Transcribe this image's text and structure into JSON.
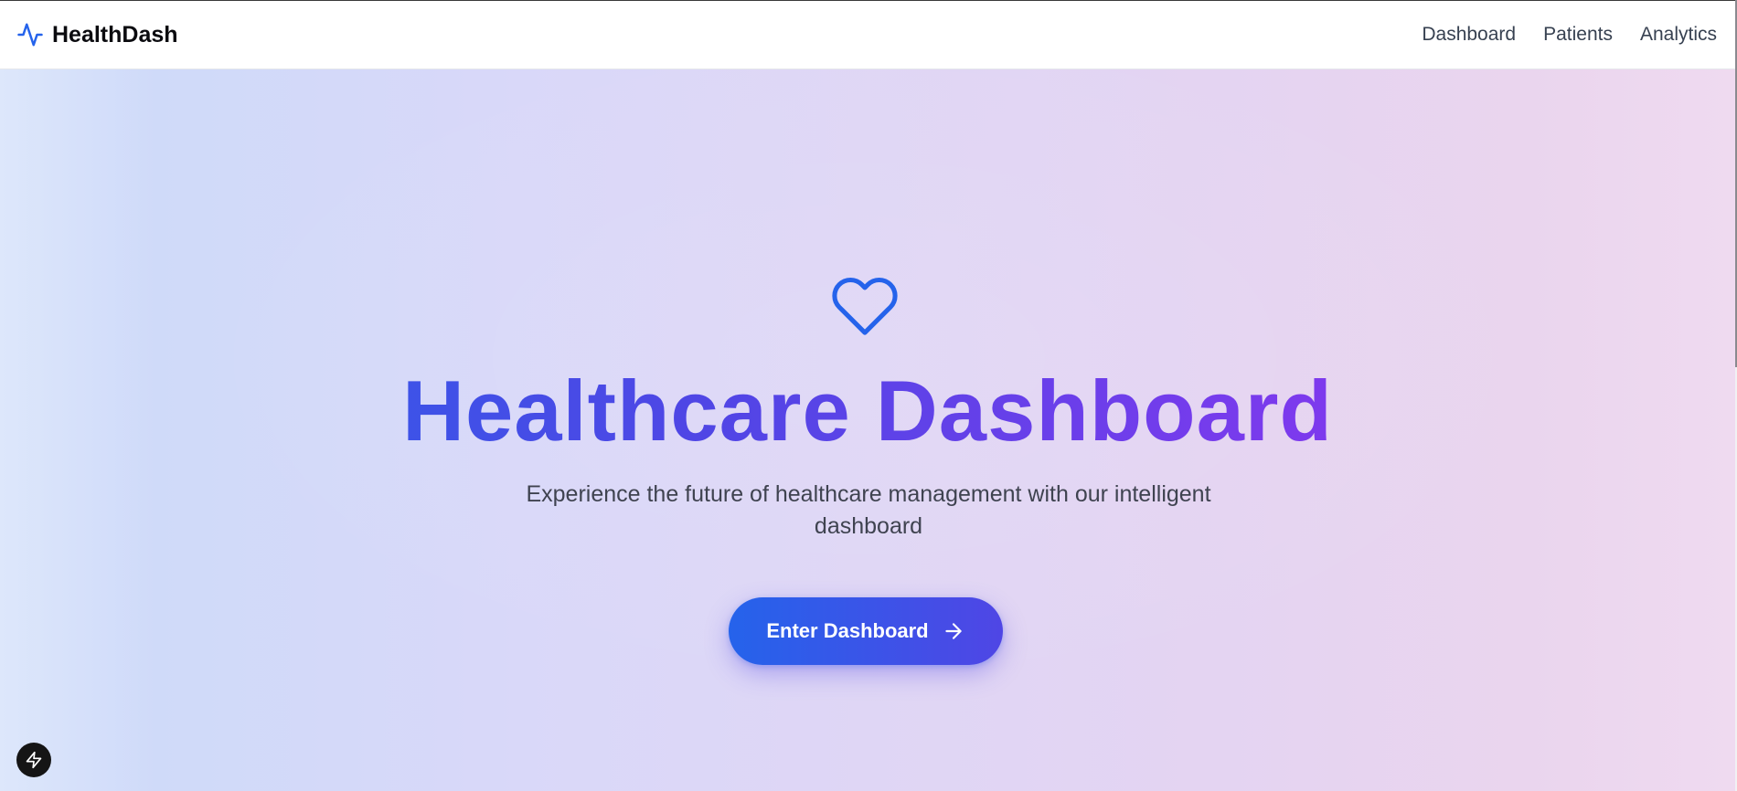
{
  "header": {
    "brand_name": "HealthDash",
    "logo_icon": "activity-pulse-icon",
    "nav": [
      {
        "label": "Dashboard"
      },
      {
        "label": "Patients"
      },
      {
        "label": "Analytics"
      }
    ]
  },
  "hero": {
    "icon": "heart-icon",
    "title": "Healthcare Dashboard",
    "subtitle": "Experience the future of healthcare management with our intelligent dashboard",
    "cta_label": "Enter Dashboard",
    "cta_icon": "arrow-right-icon"
  },
  "floating_button": {
    "icon": "lightning-bolt-icon"
  },
  "colors": {
    "primary_blue": "#2563eb",
    "indigo": "#4f46e5",
    "purple": "#9333ea",
    "text_dark": "#0b0b0f",
    "nav_text": "#374151"
  }
}
